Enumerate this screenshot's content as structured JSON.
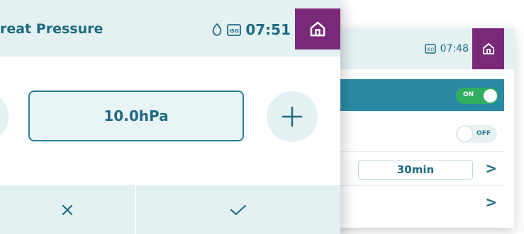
{
  "front_panel": {
    "title": "reat Pressure",
    "clock": "07:51",
    "value_display": "10.0hPa",
    "icons": {
      "status_1": "leaf-icon",
      "status_2": "iso-icon",
      "home": "home-icon",
      "minus": "minus-icon",
      "plus": "plus-icon",
      "cancel": "close-icon",
      "confirm": "check-icon"
    }
  },
  "back_panel": {
    "clock": "07:48",
    "toggle_on_label": "ON",
    "toggle_off_label": "OFF",
    "duration_value": "30min",
    "chevron": ">",
    "icons": {
      "status": "iso-icon",
      "home": "home-icon"
    }
  },
  "colors": {
    "header_bg": "#e3f1f3",
    "text_teal": "#1f6a82",
    "home_purple": "#7a2878",
    "row_blue": "#2a8aa6",
    "toggle_green": "#2fae62"
  }
}
